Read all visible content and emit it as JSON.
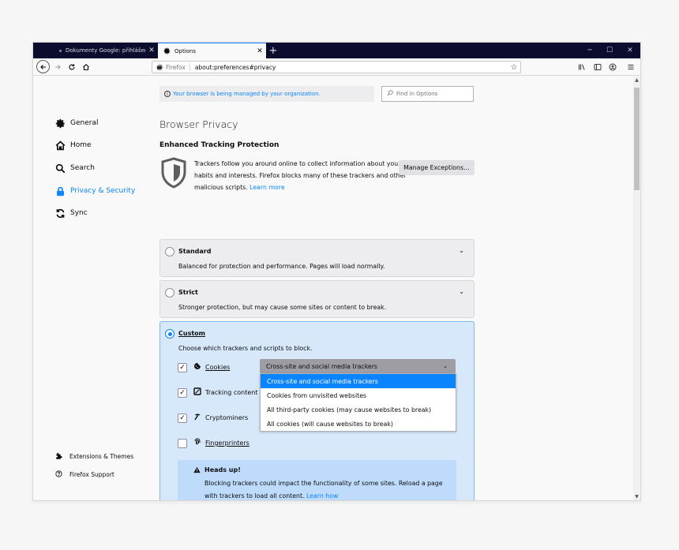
{
  "tabs": [
    {
      "title": "Dokumenty Google: přihlášení",
      "active": false
    },
    {
      "title": "Options",
      "active": true
    }
  ],
  "urlbar": {
    "identity": "Firefox",
    "url": "about:preferences#privacy"
  },
  "sidebar": {
    "items": [
      {
        "label": "General",
        "icon": "gear-icon"
      },
      {
        "label": "Home",
        "icon": "home-icon"
      },
      {
        "label": "Search",
        "icon": "search-icon"
      },
      {
        "label": "Privacy & Security",
        "icon": "lock-icon",
        "selected": true
      },
      {
        "label": "Sync",
        "icon": "sync-icon"
      }
    ],
    "footer": [
      {
        "label": "Extensions & Themes",
        "icon": "puzzle-icon"
      },
      {
        "label": "Firefox Support",
        "icon": "help-icon"
      }
    ]
  },
  "policy_notice": "Your browser is being managed by your organization.",
  "search_placeholder": "Find in Options",
  "page_title": "Browser Privacy",
  "etp": {
    "title": "Enhanced Tracking Protection",
    "description": "Trackers follow you around online to collect information about your browsing habits and interests. Firefox blocks many of these trackers and other malicious scripts.",
    "learn_more": "Learn more",
    "manage_button": "Manage Exceptions…"
  },
  "modes": {
    "standard": {
      "name": "Standard",
      "description": "Balanced for protection and performance. Pages will load normally."
    },
    "strict": {
      "name": "Strict",
      "description": "Stronger protection, but may cause some sites or content to break."
    },
    "custom": {
      "name": "Custom",
      "description": "Choose which trackers and scripts to block.",
      "selected": true
    }
  },
  "trackers": {
    "cookies": {
      "label": "Cookies",
      "checked": true
    },
    "tracking": {
      "label": "Tracking content",
      "checked": true
    },
    "crypto": {
      "label": "Cryptominers",
      "checked": true
    },
    "finger": {
      "label": "Fingerprinters",
      "checked": false
    }
  },
  "cookie_select": {
    "value": "Cross-site and social media trackers",
    "options": [
      "Cross-site and social media trackers",
      "Cookies from unvisited websites",
      "All third-party cookies (may cause websites to break)",
      "All cookies (will cause websites to break)"
    ]
  },
  "heads_up": {
    "title": "Heads up!",
    "body": "Blocking trackers could impact the functionality of some sites. Reload a page with trackers to load all content.",
    "link": "Learn how"
  },
  "colors": {
    "accent": "#0a84ff",
    "titlebar": "#0c0c2f",
    "custom_card": "#d7e8fb"
  }
}
